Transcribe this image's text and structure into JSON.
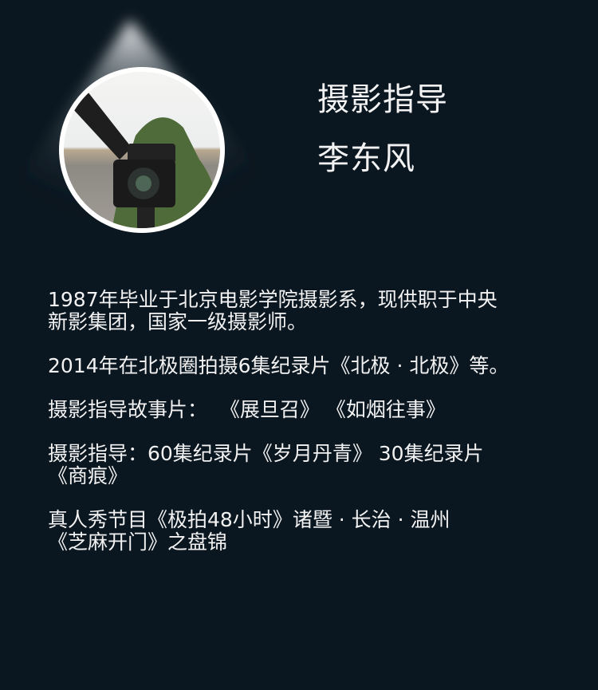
{
  "header": {
    "title": "摄影指导",
    "name": "李东风"
  },
  "bio": [
    "1987年毕业于北京电影学院摄影系，现供职于中央\n新影集团，国家一级摄影师。",
    "2014年在北极圈拍摄6集纪录片《北极 · 北极》等。",
    "摄影指导故事片：  《展旦召》 《如烟往事》",
    "摄影指导：60集纪录片《岁月丹青》 30集纪录片\n《商痕》",
    "真人秀节目《极拍48小时》诸暨 · 长治 · 温州\n《芝麻开门》之盘锦"
  ],
  "colors": {
    "background": "#0b1720",
    "text": "#f2f2f2"
  }
}
